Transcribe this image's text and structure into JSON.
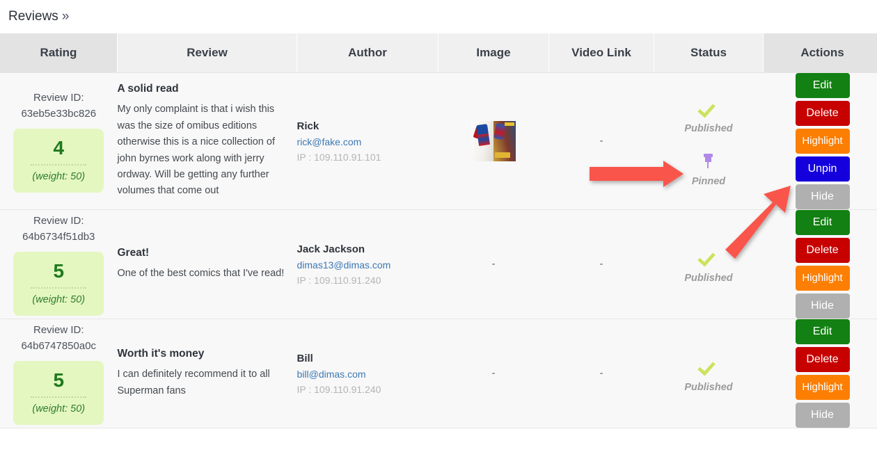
{
  "breadcrumb": {
    "label": "Reviews",
    "separator": "»"
  },
  "table": {
    "columns": [
      {
        "key": "rating",
        "label": "Rating"
      },
      {
        "key": "review",
        "label": "Review"
      },
      {
        "key": "author",
        "label": "Author"
      },
      {
        "key": "image",
        "label": "Image"
      },
      {
        "key": "video",
        "label": "Video Link"
      },
      {
        "key": "status",
        "label": "Status"
      },
      {
        "key": "actions",
        "label": "Actions"
      }
    ],
    "empty_value": "-",
    "review_id_label": "Review ID:",
    "ip_prefix": "IP : ",
    "rows": [
      {
        "review_id_label": "Review ID:",
        "review_id": "63eb5e33bc826",
        "rating": "4",
        "weight": "(weight: 50)",
        "title": "A solid read",
        "body": "My only complaint is that i wish this was the size of omibus editions otherwise this is a nice collection of john byrnes work along with jerry ordway. Will be getting any further volumes that come out",
        "author_name": "Rick",
        "author_email": "rick@fake.com",
        "author_ip": "IP : 109.110.91.101",
        "image": "comic-book-photo",
        "video": "-",
        "statuses": [
          {
            "icon": "check-icon",
            "label": "Published"
          },
          {
            "icon": "pin-icon",
            "label": "Pinned"
          }
        ],
        "actions": [
          {
            "label": "Edit",
            "style": "act-edit"
          },
          {
            "label": "Delete",
            "style": "act-delete"
          },
          {
            "label": "Highlight",
            "style": "act-highlight"
          },
          {
            "label": "Unpin",
            "style": "act-unpin"
          },
          {
            "label": "Hide",
            "style": "act-hide"
          }
        ]
      },
      {
        "review_id_label": "Review ID:",
        "review_id": "64b6734f51db3",
        "rating": "5",
        "weight": "(weight: 50)",
        "title": "Great!",
        "body": "One of the best comics that I've read!",
        "author_name": "Jack Jackson",
        "author_email": "dimas13@dimas.com",
        "author_ip": "IP : 109.110.91.240",
        "image": "-",
        "video": "-",
        "statuses": [
          {
            "icon": "check-icon",
            "label": "Published"
          }
        ],
        "actions": [
          {
            "label": "Edit",
            "style": "act-edit"
          },
          {
            "label": "Delete",
            "style": "act-delete"
          },
          {
            "label": "Highlight",
            "style": "act-highlight"
          },
          {
            "label": "Hide",
            "style": "act-hide"
          }
        ]
      },
      {
        "review_id_label": "Review ID:",
        "review_id": "64b6747850a0c",
        "rating": "5",
        "weight": "(weight: 50)",
        "title": "Worth it's money",
        "body": "I can definitely recommend it to all Superman fans",
        "author_name": "Bill",
        "author_email": "bill@dimas.com",
        "author_ip": "IP : 109.110.91.240",
        "image": "-",
        "video": "-",
        "statuses": [
          {
            "icon": "check-icon",
            "label": "Published"
          }
        ],
        "actions": [
          {
            "label": "Edit",
            "style": "act-edit"
          },
          {
            "label": "Delete",
            "style": "act-delete"
          },
          {
            "label": "Highlight",
            "style": "act-highlight"
          },
          {
            "label": "Hide",
            "style": "act-hide"
          }
        ]
      }
    ]
  },
  "annotations": {
    "arrow_color": "#f9544b",
    "arrows": [
      {
        "name": "arrow-to-pinned-status",
        "points_at": "Pinned"
      },
      {
        "name": "arrow-to-unpin-button",
        "points_at": "Unpin"
      }
    ]
  },
  "colors": {
    "edit": "#128012",
    "delete": "#c70000",
    "highlight": "#fc7f03",
    "unpin": "#1400dc",
    "hide": "#b0b0b0",
    "rating_box": "#e4f7c0",
    "rating_text": "#1e7a1e",
    "check": "#cbe35c",
    "pin": "#b18ae8",
    "link": "#3c78b4",
    "header_bg": "#f0f0f0",
    "header_shaded_bg": "#e3e3e3"
  }
}
